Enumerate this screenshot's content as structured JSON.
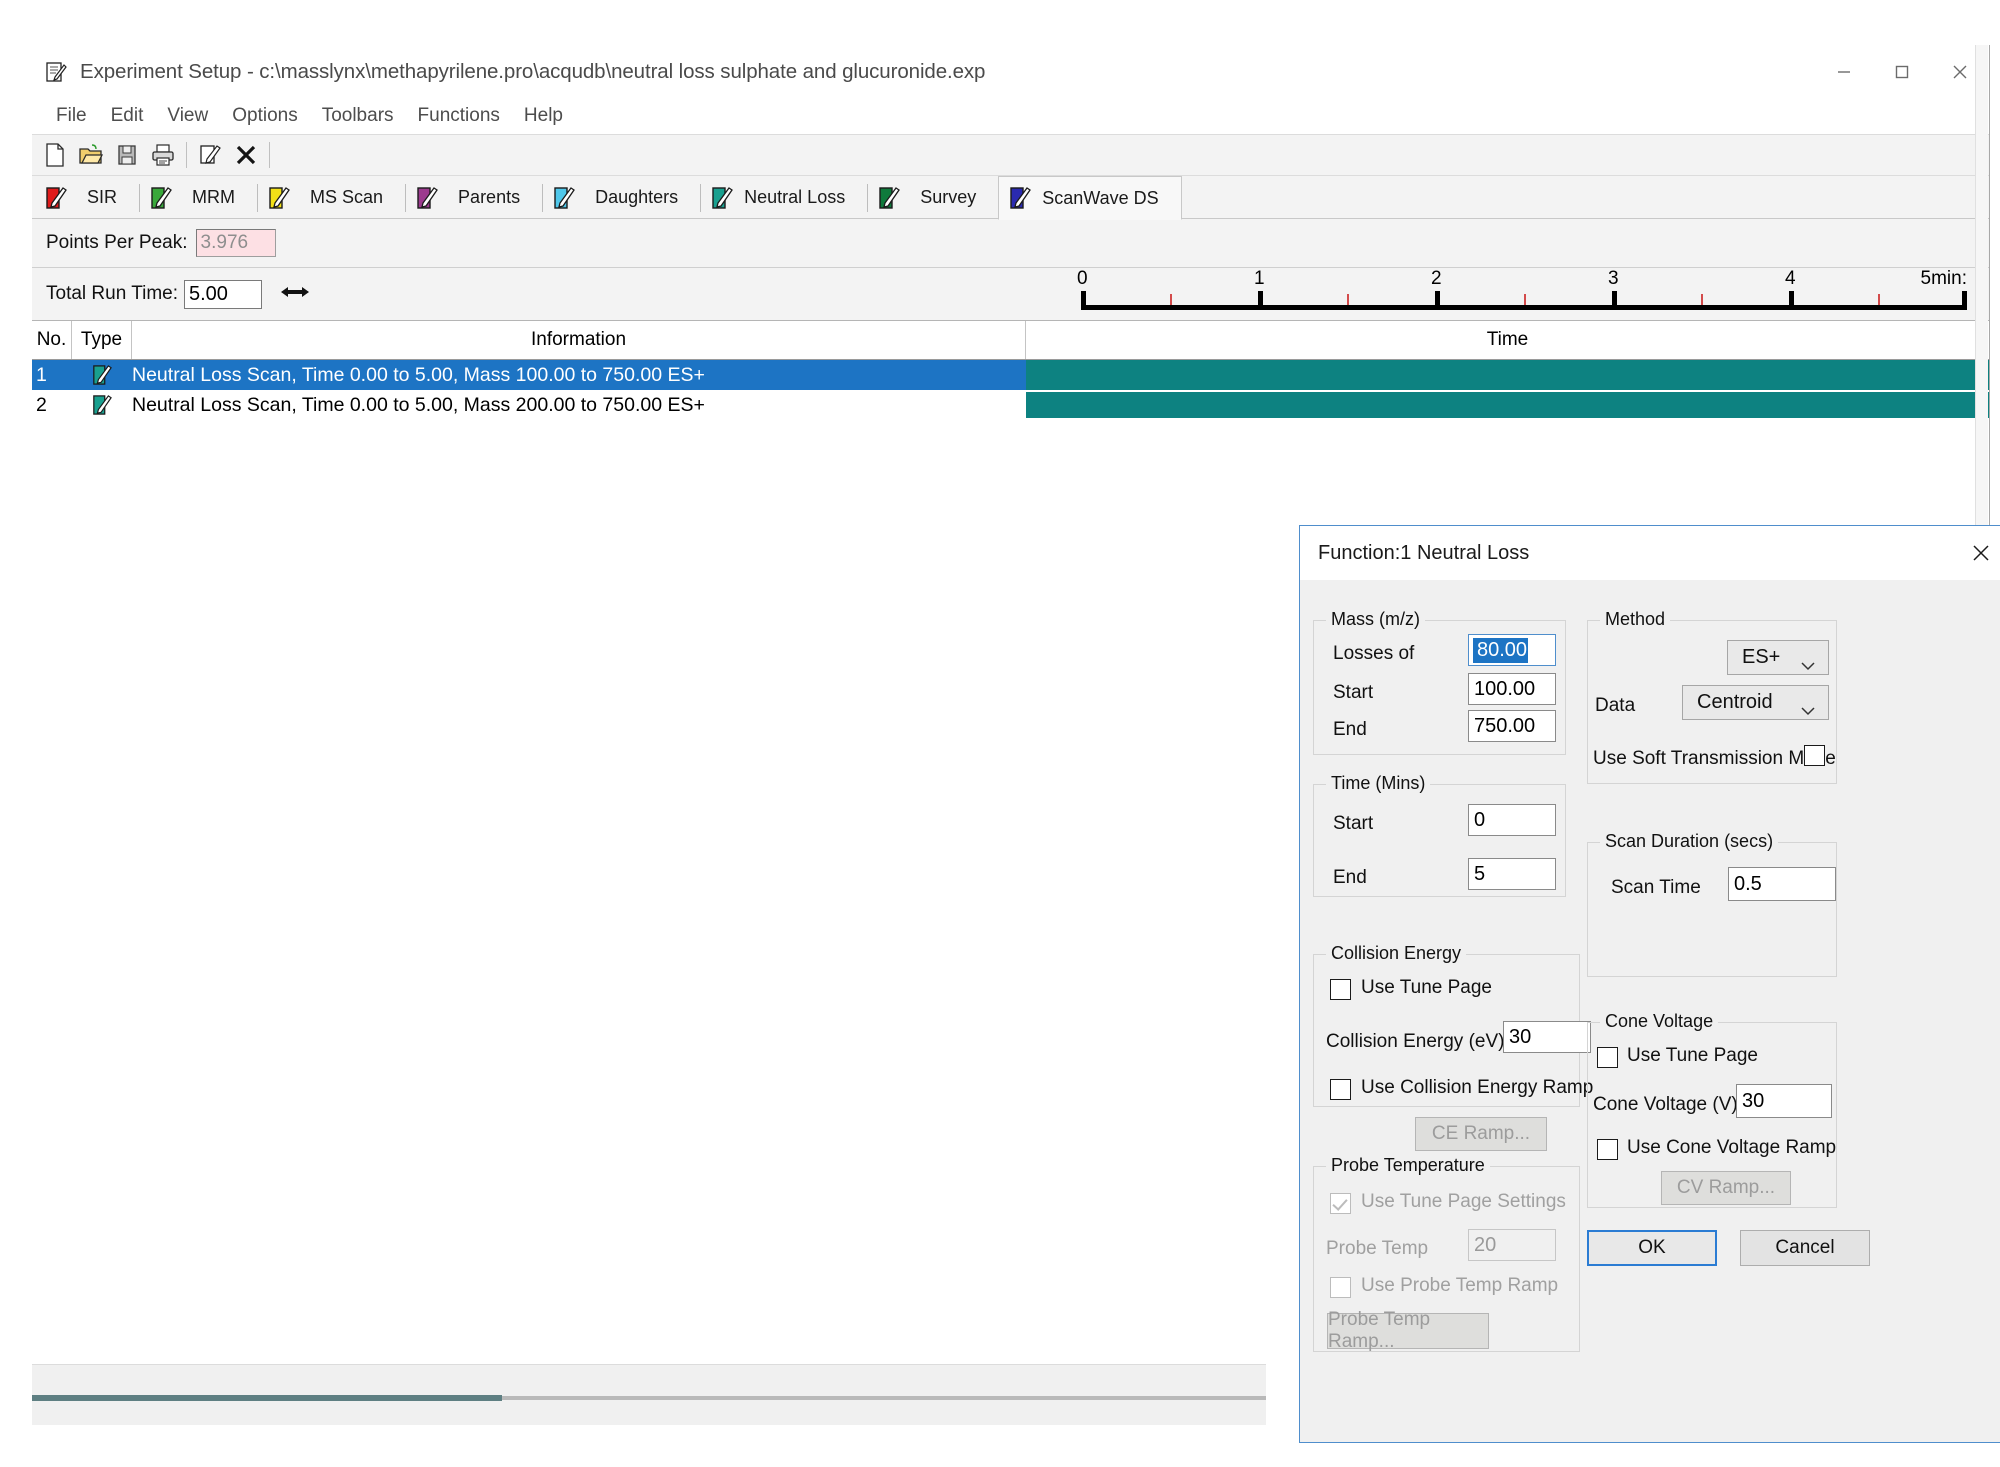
{
  "window": {
    "title": "Experiment Setup - c:\\masslynx\\methapyrilene.pro\\acqudb\\neutral loss sulphate and glucuronide.exp",
    "icon": "experiment-setup-icon",
    "controls": {
      "minimize": "minimize-icon",
      "maximize": "maximize-icon",
      "close": "close-icon"
    }
  },
  "menu": {
    "items": [
      "File",
      "Edit",
      "View",
      "Options",
      "Toolbars",
      "Functions",
      "Help"
    ]
  },
  "toolbar": {
    "buttons": [
      {
        "name": "new-icon"
      },
      {
        "name": "open-icon"
      },
      {
        "name": "save-icon"
      },
      {
        "name": "print-icon"
      },
      {
        "name": "edit-icon"
      },
      {
        "name": "delete-icon"
      }
    ]
  },
  "tabs": [
    {
      "label": "SIR",
      "color": "#e01b1b",
      "active": false
    },
    {
      "label": "MRM",
      "color": "#39a83b",
      "active": false
    },
    {
      "label": "MS Scan",
      "color": "#f2e017",
      "active": false
    },
    {
      "label": "Parents",
      "color": "#9c3a8e",
      "active": false
    },
    {
      "label": "Daughters",
      "color": "#4fc7ea",
      "active": false
    },
    {
      "label": "Neutral Loss",
      "color": "#19a08f",
      "active": false
    },
    {
      "label": "Survey",
      "color": "#0f7a3c",
      "active": false
    },
    {
      "label": "ScanWave DS",
      "color": "#2a2ab0",
      "active": true
    }
  ],
  "points_per_peak": {
    "label": "Points Per Peak:",
    "value": "3.976"
  },
  "run_time": {
    "label": "Total Run Time:",
    "value": "5.00",
    "resize_icon": "horizontal-resize-icon"
  },
  "ruler": {
    "major_ticks": [
      "0",
      "1",
      "2",
      "3",
      "4",
      "5min:"
    ],
    "major_values": [
      0,
      1,
      2,
      3,
      4,
      5
    ],
    "minor_values": [
      0.5,
      1.5,
      2.5,
      3.5,
      4.5
    ],
    "unit": "min",
    "max": 5
  },
  "table": {
    "headers": {
      "no": "No.",
      "type": "Type",
      "information": "Information",
      "time": "Time"
    },
    "rows": [
      {
        "no": "1",
        "type_icon": "neutral-loss-function-icon",
        "information": "Neutral Loss Scan, Time 0.00 to 5.00, Mass 100.00 to 750.00 ES+",
        "bar_start": 0,
        "bar_end": 5,
        "selected": true
      },
      {
        "no": "2",
        "type_icon": "neutral-loss-function-icon",
        "information": "Neutral Loss Scan, Time 0.00 to 5.00, Mass 200.00 to 750.00 ES+",
        "bar_start": 0,
        "bar_end": 5,
        "selected": false
      }
    ]
  },
  "dialog": {
    "title": "Function:1 Neutral Loss",
    "close_icon": "close-icon",
    "mass": {
      "legend": "Mass (m/z)",
      "losses_of_label": "Losses of",
      "losses_of_value": "80.00",
      "start_label": "Start",
      "start_value": "100.00",
      "end_label": "End",
      "end_value": "750.00"
    },
    "time": {
      "legend": "Time (Mins)",
      "start_label": "Start",
      "start_value": "0",
      "end_label": "End",
      "end_value": "5"
    },
    "collision_energy": {
      "legend": "Collision Energy",
      "use_tune_page_label": "Use Tune Page",
      "use_tune_page_checked": false,
      "value_label": "Collision Energy (eV)",
      "value": "30",
      "use_ramp_label": "Use Collision Energy Ramp",
      "use_ramp_checked": false,
      "ramp_button": "CE Ramp...",
      "ramp_button_enabled": false
    },
    "probe_temperature": {
      "legend": "Probe Temperature",
      "use_tune_page_settings_label": "Use Tune Page Settings",
      "use_tune_page_settings_checked": true,
      "probe_temp_label": "Probe Temp",
      "probe_temp_value": "20",
      "use_ramp_label": "Use Probe Temp Ramp",
      "use_ramp_checked": false,
      "ramp_button": "Probe Temp Ramp...",
      "ramp_button_enabled": false
    },
    "method": {
      "legend": "Method",
      "ionisation_value": "ES+",
      "data_label": "Data",
      "data_value": "Centroid",
      "soft_transmission_label": "Use Soft Transmission Mode",
      "soft_transmission_checked": false
    },
    "scan_duration": {
      "legend": "Scan Duration (secs)",
      "scan_time_label": "Scan Time",
      "scan_time_value": "0.5"
    },
    "cone_voltage": {
      "legend": "Cone Voltage",
      "use_tune_page_label": "Use Tune Page",
      "use_tune_page_checked": false,
      "value_label": "Cone Voltage (V)",
      "value": "30",
      "use_ramp_label": "Use Cone Voltage Ramp",
      "use_ramp_checked": false,
      "ramp_button": "CV Ramp...",
      "ramp_button_enabled": false
    },
    "ok_label": "OK",
    "cancel_label": "Cancel"
  },
  "colors": {
    "selection_blue": "#1d74c4",
    "timeline_teal": "#0d8281",
    "accent_border": "#4f8ecc",
    "error_field_bg": "#fde0e4"
  }
}
